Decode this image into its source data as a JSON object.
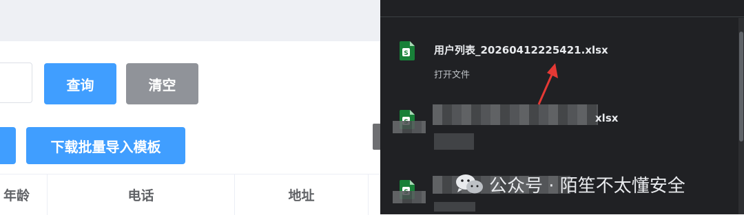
{
  "toolbar": {
    "query_label": "查询",
    "clear_label": "清空",
    "template_label": "下载批量导入模板"
  },
  "table": {
    "headers": [
      "年龄",
      "电话",
      "地址"
    ]
  },
  "downloads": {
    "items": [
      {
        "file_name": "用户列表_20260412225421.xlsx",
        "action": "打开文件",
        "icon": "excel-file-icon"
      },
      {
        "file_name_suffix": "xlsx",
        "icon": "excel-file-icon"
      },
      {
        "icon": "excel-file-icon"
      }
    ]
  },
  "watermark": {
    "text": "公众号 · 陌笙不太懂安全",
    "icon": "wechat-icon"
  },
  "colors": {
    "primary": "#409eff",
    "secondary": "#909399",
    "panel_bg": "#202124",
    "annotation_arrow": "#e53935"
  }
}
